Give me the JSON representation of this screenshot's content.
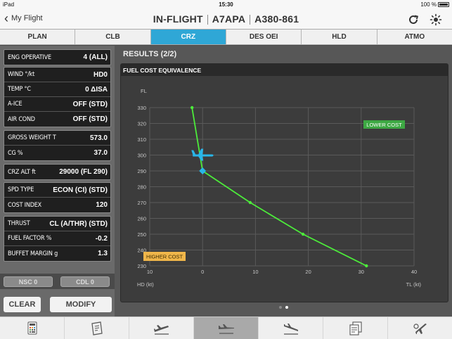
{
  "status": {
    "device": "iPad",
    "time": "15:30",
    "battery": "100 %"
  },
  "nav": {
    "back_label": "My Flight",
    "title_parts": [
      "IN-FLIGHT",
      "A7APA",
      "A380-861"
    ]
  },
  "tabs": [
    {
      "label": "PLAN",
      "active": false
    },
    {
      "label": "CLB",
      "active": false
    },
    {
      "label": "CRZ",
      "active": true
    },
    {
      "label": "DES OEI",
      "active": false
    },
    {
      "label": "HLD",
      "active": false
    },
    {
      "label": "ATMO",
      "active": false
    }
  ],
  "params": {
    "eng_operative": {
      "label": "ENG OPERATIVE",
      "value": "4 (ALL)"
    },
    "wind": {
      "label": "WIND °/kt",
      "value": "HD0"
    },
    "temp": {
      "label": "TEMP °C",
      "value": "0 ΔISA"
    },
    "aice": {
      "label": "A-ICE",
      "value": "OFF (STD)"
    },
    "air_cond": {
      "label": "AIR COND",
      "value": "OFF (STD)"
    },
    "gross_weight": {
      "label": "GROSS WEIGHT T",
      "value": "573.0"
    },
    "cg": {
      "label": "CG %",
      "value": "37.0"
    },
    "crz_alt": {
      "label": "CRZ ALT ft",
      "value": "29000 (FL 290)"
    },
    "spd_type": {
      "label": "SPD TYPE",
      "value": "ECON (CI) (STD)"
    },
    "cost_index": {
      "label": "COST INDEX",
      "value": "120"
    },
    "thrust": {
      "label": "THRUST",
      "value": "CL (A/THR) (STD)"
    },
    "fuel_factor": {
      "label": "FUEL FACTOR %",
      "value": "-0.2"
    },
    "buffet_margin": {
      "label": "BUFFET MARGIN g",
      "value": "1.3"
    }
  },
  "messages": {
    "nsc": "NSC 0",
    "cdl": "CDL 0"
  },
  "actions": {
    "clear": "CLEAR",
    "modify": "MODIFY"
  },
  "results": {
    "title": "RESULTS (2/2)",
    "card_title": "FUEL COST EQUIVALENCE"
  },
  "chart_data": {
    "type": "line",
    "title": "FUEL COST EQUIVALENCE",
    "ylabel": "FL",
    "xlabel_left": "HD (kt)",
    "xlabel_right": "TL (kt)",
    "xlim": [
      -10,
      40
    ],
    "ylim": [
      230,
      330
    ],
    "xticks": [
      10,
      0,
      10,
      20,
      30,
      40
    ],
    "xtick_values": [
      -10,
      0,
      10,
      20,
      30,
      40
    ],
    "yticks": [
      230,
      240,
      250,
      260,
      270,
      280,
      290,
      300,
      310,
      320,
      330
    ],
    "grid": true,
    "series": [
      {
        "x": [
          -2,
          0,
          9,
          19,
          31
        ],
        "y": [
          330,
          290,
          270,
          250,
          230
        ]
      }
    ],
    "current_point": {
      "x": 0,
      "y": 290
    },
    "aircraft_position": {
      "x": 0,
      "y": 300
    },
    "annotations": {
      "lower_cost": "LOWER COST",
      "higher_cost": "HIGHER COST"
    },
    "colors": {
      "line": "#4cec3a",
      "current": "#29b6e8",
      "lower_cost": "#3da843",
      "higher_cost": "#f0b64a",
      "grid": "#5a5a5a"
    }
  },
  "pager": {
    "pages": 2,
    "current": 2
  },
  "toolbar": [
    {
      "icon": "calculator-icon",
      "active": false
    },
    {
      "icon": "manual-icon",
      "active": false
    },
    {
      "icon": "takeoff-icon",
      "active": false
    },
    {
      "icon": "cruise-icon",
      "active": true
    },
    {
      "icon": "landing-icon",
      "active": false
    },
    {
      "icon": "documents-icon",
      "active": false
    },
    {
      "icon": "settings-plane-icon",
      "active": false
    }
  ]
}
